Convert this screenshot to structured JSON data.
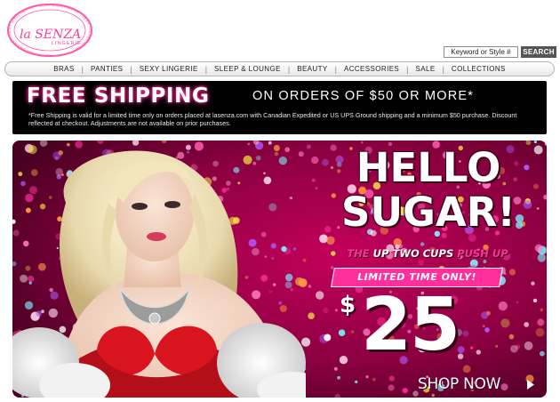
{
  "logo": {
    "brand_text": "la SENZA",
    "tagline": "LINGERIE",
    "ring_text": "SEXY UNDERWEAR · SEXY UNDERWEAR · SEXY UNDERWEAR · SEXY UNDERWEAR ·"
  },
  "search": {
    "placeholder": "Keyword or Style #",
    "button_label": "SEARCH"
  },
  "nav": {
    "items": [
      "BRAS",
      "PANTIES",
      "SEXY LINGERIE",
      "SLEEP & LOUNGE",
      "BEAUTY",
      "ACCESSORIES",
      "SALE",
      "COLLECTIONS"
    ]
  },
  "shipping_banner": {
    "title": "FREE SHIPPING",
    "subtitle": "ON ORDERS OF $50 OR MORE*",
    "fine_print": "*Free Shipping is valid for a limited time only on orders placed at lasenza.com with Canadian Expedited or US UPS Ground shipping and a minimum $50 purchase. Discount reflected at checkout. Adjustments are not available on prior purchases."
  },
  "hero": {
    "headline_line1": "HELLO",
    "headline_line2": "SUGAR!",
    "promo_part1": "THE ",
    "promo_highlight1": "UP TWO CUPS",
    "promo_part2": " PUSH UP",
    "limited": "LIMITED TIME ONLY!",
    "price_symbol": "$",
    "price": "25",
    "cta": "SHOP NOW"
  },
  "colors": {
    "accent_pink": "#ff2f9b",
    "hero_bg": "#7b0035",
    "banner_bg": "#000000",
    "bra_red": "#d8141e"
  }
}
